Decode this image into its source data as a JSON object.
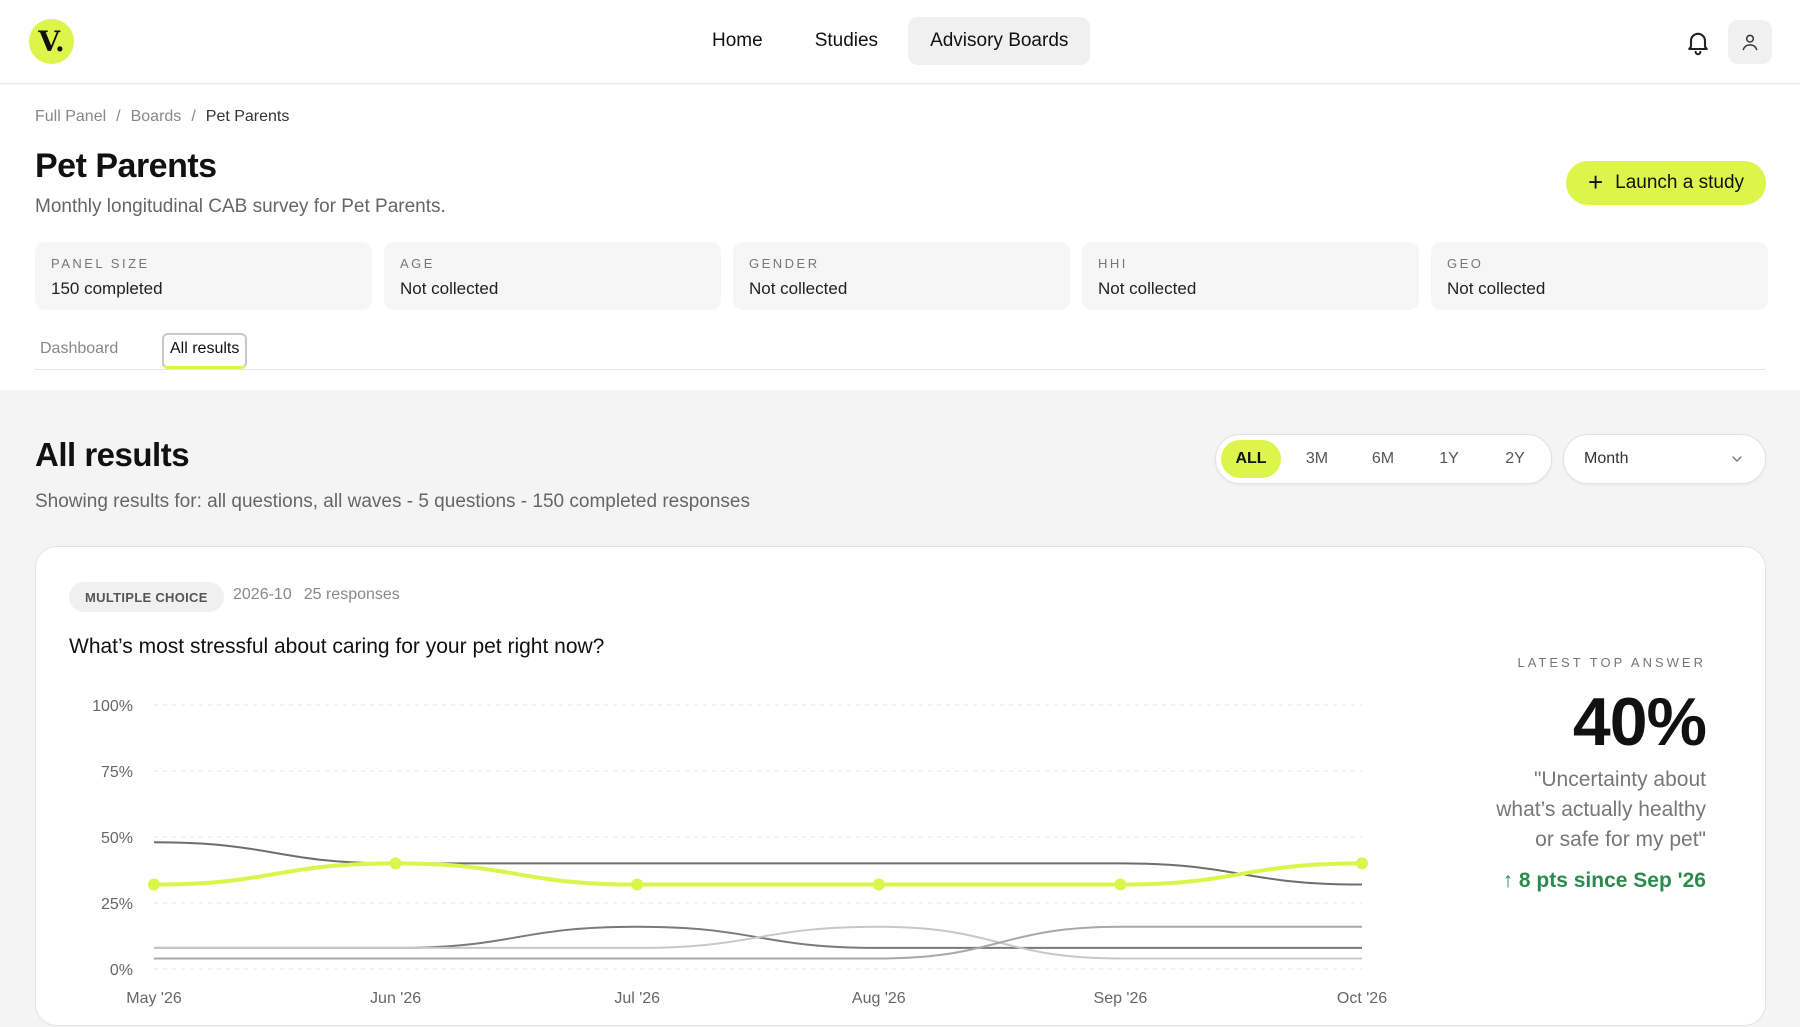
{
  "app": {
    "logo_text": "V."
  },
  "nav": {
    "items": [
      "Home",
      "Studies",
      "Advisory Boards"
    ],
    "active": "Advisory Boards"
  },
  "breadcrumb": [
    "Full Panel",
    "Boards",
    "Pet Parents"
  ],
  "page": {
    "title": "Pet Parents",
    "subtitle": "Monthly longitudinal CAB survey for Pet Parents.",
    "launch_label": "Launch a study"
  },
  "stats": [
    {
      "label": "PANEL SIZE",
      "value": "150 completed"
    },
    {
      "label": "AGE",
      "value": "Not collected"
    },
    {
      "label": "GENDER",
      "value": "Not collected"
    },
    {
      "label": "HHI",
      "value": "Not collected"
    },
    {
      "label": "GEO",
      "value": "Not collected"
    }
  ],
  "tabs": [
    "Dashboard",
    "All results"
  ],
  "results": {
    "title": "All results",
    "subtitle": "Showing results for: all questions, all waves - 5 questions - 150 completed responses",
    "ranges": [
      "ALL",
      "3M",
      "6M",
      "1Y",
      "2Y"
    ],
    "active_range": "ALL",
    "granularity": "Month"
  },
  "card": {
    "type_chip": "MULTIPLE CHOICE",
    "wave": "2026-10",
    "responses": "25 responses",
    "question": "What’s most stressful about caring for your pet right now?",
    "kpi_label": "LATEST TOP ANSWER",
    "kpi_value": "40%",
    "kpi_answer": "\"Uncertainty about what’s actually healthy or safe for my pet\"",
    "kpi_delta": "8 pts since Sep '26"
  },
  "colors": {
    "accent": "#dcf54a",
    "positive": "#2d8a4e"
  },
  "chart_data": {
    "type": "line",
    "x": [
      "May '26",
      "Jun '26",
      "Jul '26",
      "Aug '26",
      "Sep '26",
      "Oct '26"
    ],
    "ylim": [
      0,
      100
    ],
    "yticks": [
      "100%",
      "75%",
      "50%",
      "25%",
      "0%"
    ],
    "series": [
      {
        "values": [
          32,
          40,
          32,
          32,
          32,
          40
        ],
        "color": "#dcf54a",
        "highlight": true
      },
      {
        "values": [
          48,
          40,
          40,
          40,
          40,
          32
        ],
        "color": "#6e6e6e"
      },
      {
        "values": [
          8,
          8,
          16,
          8,
          8,
          8
        ],
        "color": "#7a7a7a"
      },
      {
        "values": [
          8,
          8,
          8,
          16,
          4,
          4
        ],
        "color": "#c8c8c8"
      },
      {
        "values": [
          4,
          4,
          4,
          4,
          16,
          16
        ],
        "color": "#a8a8a8"
      }
    ],
    "grid": true
  }
}
